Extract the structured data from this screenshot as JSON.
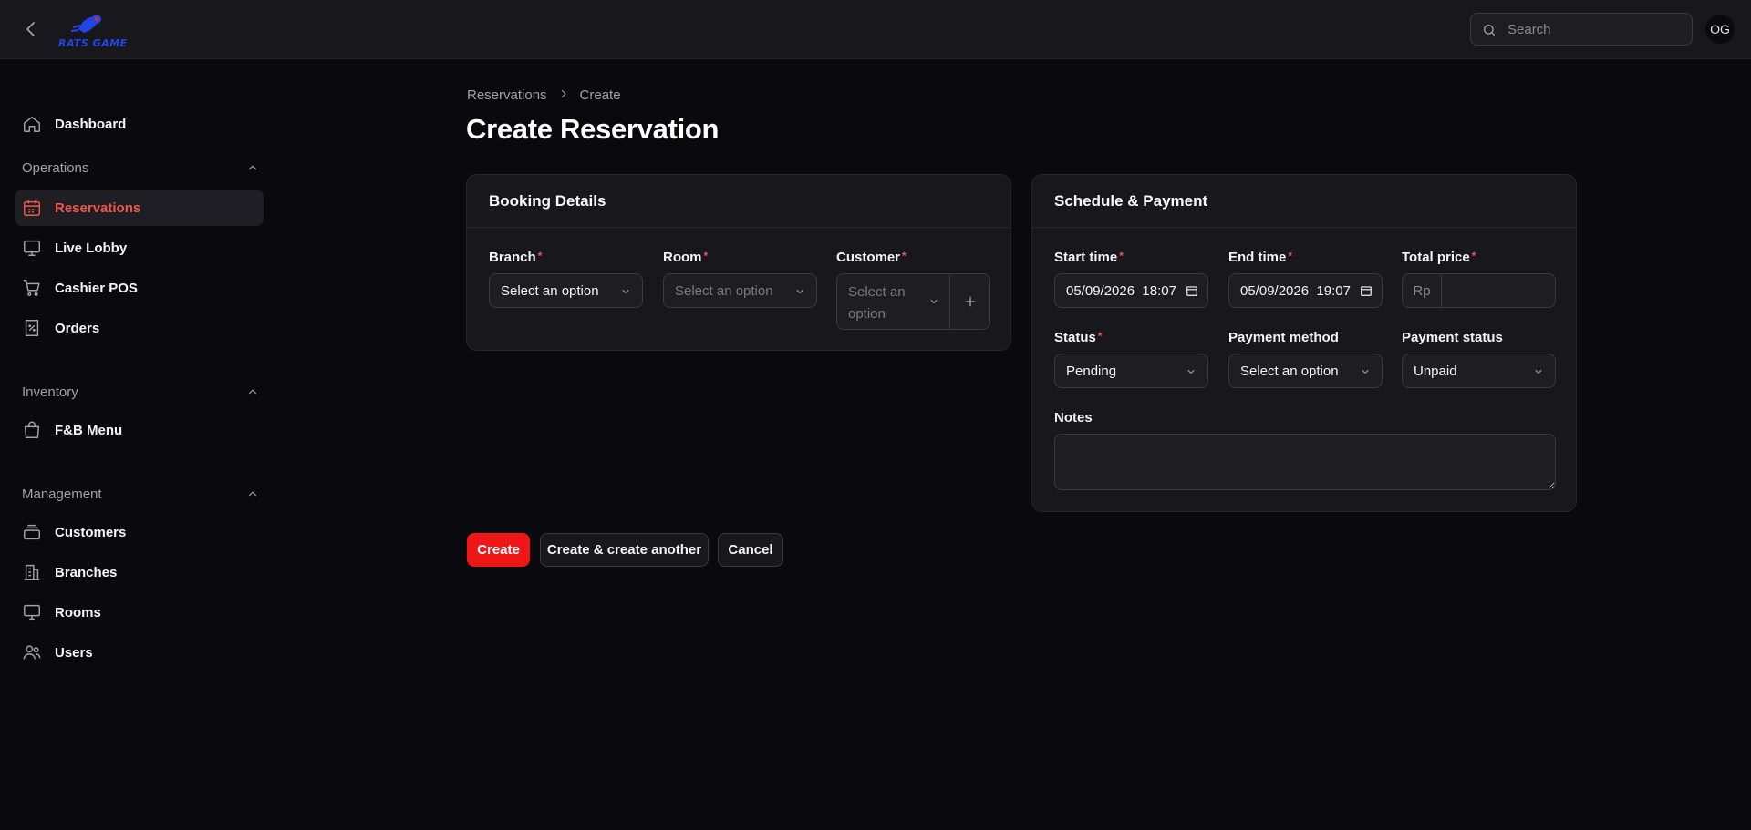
{
  "app": {
    "logo_text": "RATS GAME",
    "user_initials": "OG"
  },
  "search": {
    "placeholder": "Search"
  },
  "sidebar": {
    "dashboard": "Dashboard",
    "groups": {
      "operations": "Operations",
      "inventory": "Inventory",
      "management": "Management"
    },
    "items": {
      "reservations": "Reservations",
      "live_lobby": "Live Lobby",
      "cashier_pos": "Cashier POS",
      "orders": "Orders",
      "fb_menu": "F&B Menu",
      "customers": "Customers",
      "branches": "Branches",
      "rooms": "Rooms",
      "users": "Users"
    }
  },
  "breadcrumb": {
    "parent": "Reservations",
    "current": "Create"
  },
  "page": {
    "title": "Create Reservation"
  },
  "booking": {
    "title": "Booking Details",
    "branch_label": "Branch",
    "branch_value": "Select an option",
    "room_label": "Room",
    "room_value": "Select an option",
    "customer_label": "Customer",
    "customer_value_line1": "Select an",
    "customer_value_line2": "option"
  },
  "schedule": {
    "title": "Schedule & Payment",
    "start_label": "Start time",
    "start_value": "05/09/2026  18:07",
    "end_label": "End time",
    "end_value": "05/09/2026  19:07",
    "price_label": "Total price",
    "price_prefix": "Rp",
    "price_value": "",
    "status_label": "Status",
    "status_value": "Pending",
    "payment_method_label": "Payment method",
    "payment_method_value": "Select an option",
    "payment_status_label": "Payment status",
    "payment_status_value": "Unpaid",
    "notes_label": "Notes",
    "notes_value": ""
  },
  "actions": {
    "create": "Create",
    "create_another": "Create & create another",
    "cancel": "Cancel"
  },
  "colors": {
    "accent": "#f0564a",
    "primary_button": "#ee1616",
    "logo": "#2146e8"
  }
}
